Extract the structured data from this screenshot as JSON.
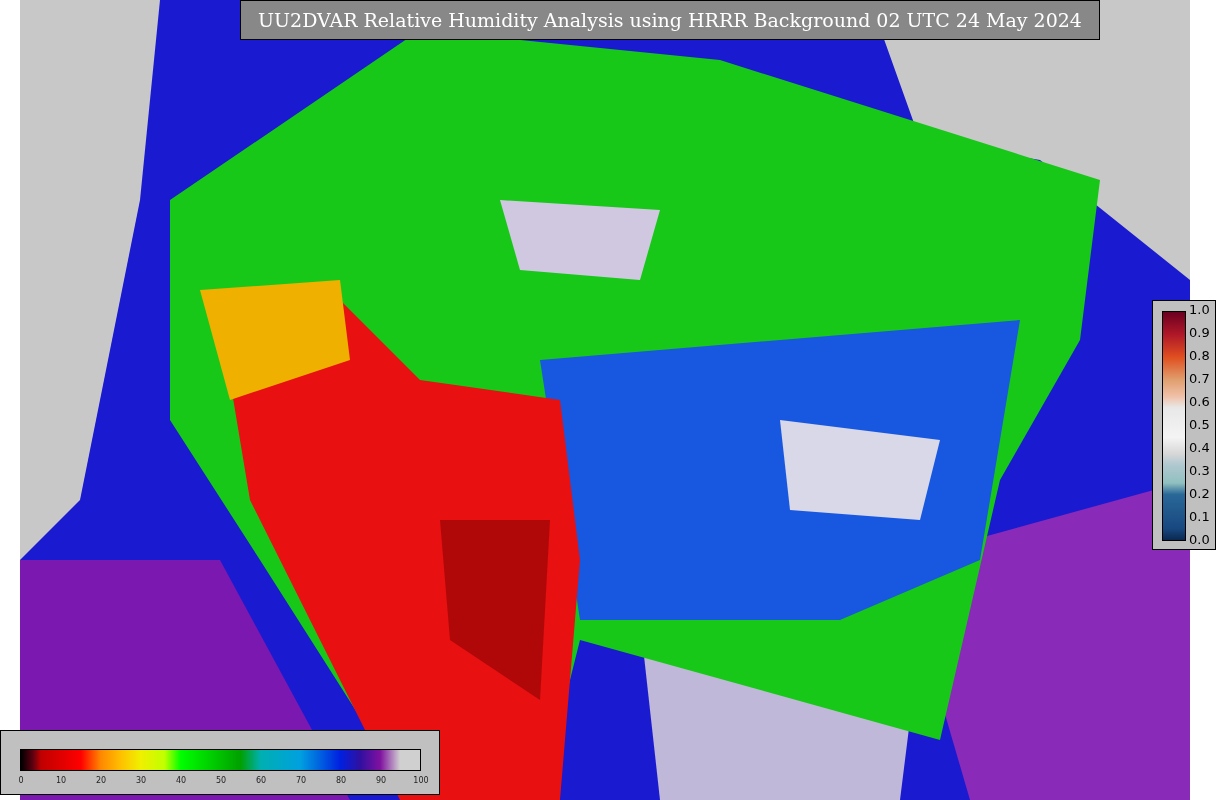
{
  "title": "UU2DVAR Relative Humidity Analysis using HRRR Background 02 UTC 24 May 2024",
  "humidity_legend": {
    "ticks": [
      "0",
      "10",
      "20",
      "30",
      "40",
      "50",
      "60",
      "70",
      "80",
      "90",
      "100"
    ]
  },
  "ratio_legend": {
    "ticks": [
      "1.0",
      "0.9",
      "0.8",
      "0.7",
      "0.6",
      "0.5",
      "0.4",
      "0.3",
      "0.2",
      "0.1",
      "0.0"
    ]
  }
}
